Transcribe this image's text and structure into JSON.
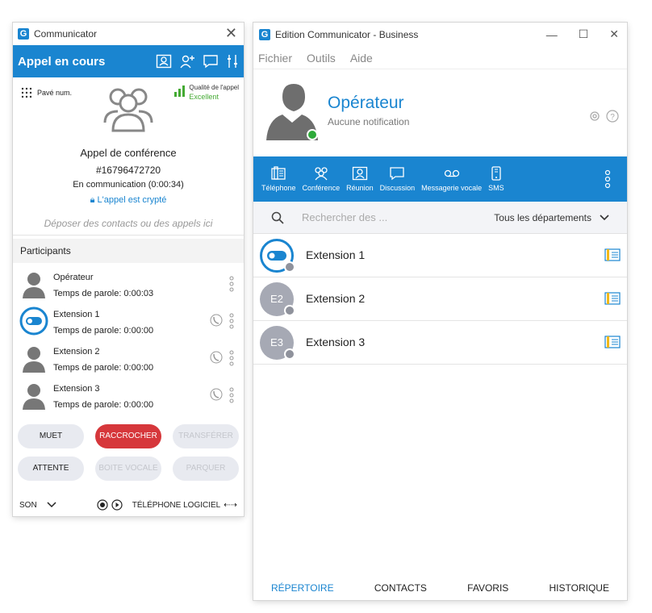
{
  "call_window": {
    "title": "Communicator",
    "header_title": "Appel en cours",
    "keypad_label": "Pavé num.",
    "quality_label": "Qualité de l'appel",
    "quality_value": "Excellent",
    "conference_title": "Appel de conférence",
    "conference_number": "#16796472720",
    "status": "En communication (0:00:34)",
    "encrypted": "L'appel est crypté",
    "drop_hint": "Déposer des contacts ou des appels ici",
    "participants_header": "Participants",
    "participants": [
      {
        "name": "Opérateur",
        "time": "Temps de parole: 0:00:03"
      },
      {
        "name": "Extension 1",
        "time": "Temps de parole: 0:00:00"
      },
      {
        "name": "Extension 2",
        "time": "Temps de parole: 0:00:00"
      },
      {
        "name": "Extension 3",
        "time": "Temps de parole: 0:00:00"
      }
    ],
    "buttons": {
      "mute": "MUET",
      "hangup": "RACCROCHER",
      "transfer": "TRANSFÉRER",
      "hold": "ATTENTE",
      "voicemail": "BOITE VOCALE",
      "park": "PARQUER"
    },
    "footer": {
      "sound": "SON",
      "softphone": "TÉLÉPHONE LOGICIEL"
    }
  },
  "main_window": {
    "title": "Edition Communicator - Business",
    "menu": [
      "Fichier",
      "Outils",
      "Aide"
    ],
    "user_name": "Opérateur",
    "user_status": "Aucune notification",
    "toolbar": [
      "Téléphone",
      "Conférence",
      "Réunion",
      "Discussion",
      "Messagerie vocale",
      "SMS"
    ],
    "search_placeholder": "Rechercher des ...",
    "department": "Tous les départements",
    "contacts": [
      {
        "name": "Extension 1",
        "initials": ""
      },
      {
        "name": "Extension 2",
        "initials": "E2"
      },
      {
        "name": "Extension 3",
        "initials": "E3"
      }
    ],
    "tabs": [
      "RÉPERTOIRE",
      "CONTACTS",
      "FAVORIS",
      "HISTORIQUE"
    ]
  },
  "colors": {
    "accent": "#1a85d0",
    "hangup": "#d6373b",
    "presence_online": "#2eaa3a",
    "quality_good": "#44aa33"
  }
}
